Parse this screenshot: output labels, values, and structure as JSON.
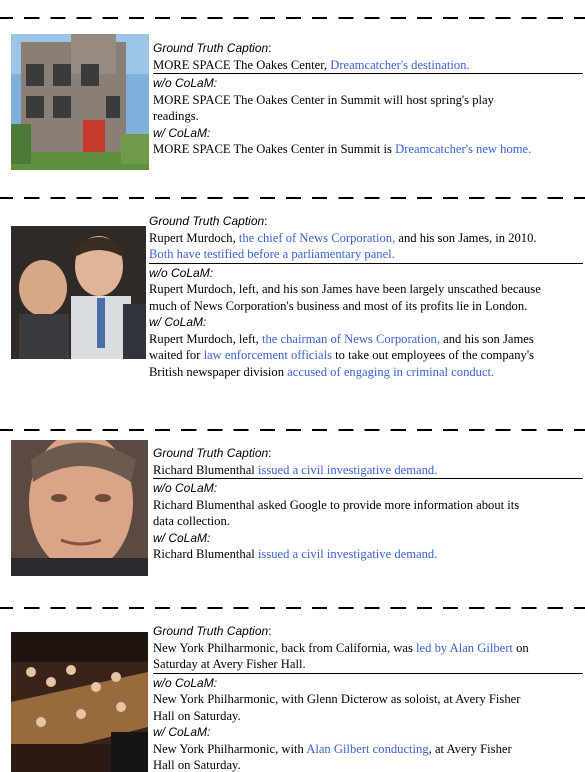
{
  "labels": {
    "gt": "Ground Truth Caption",
    "gt_colon": ":",
    "wo": "w/o CoLaM:",
    "w": "w/ CoLaM:"
  },
  "colors": {
    "highlight": "#3a62d6",
    "text": "#000000"
  },
  "examples": [
    {
      "image": "stone-building-photo",
      "gt": {
        "lines": [
          [
            {
              "t": "MORE SPACE The Oakes Center, ",
              "h": false
            },
            {
              "t": "Dreamcatcher's destination.",
              "h": true
            }
          ]
        ]
      },
      "wo": {
        "lines": [
          [
            {
              "t": "MORE SPACE The Oakes Center in Summit will host spring's play",
              "h": false
            }
          ],
          [
            {
              "t": "readings.",
              "h": false
            }
          ]
        ]
      },
      "w": {
        "lines": [
          [
            {
              "t": "MORE SPACE The Oakes Center in Summit is ",
              "h": false
            },
            {
              "t": "Dreamcatcher's new home.",
              "h": true
            }
          ]
        ]
      }
    },
    {
      "image": "two-men-photo",
      "gt": {
        "lines": [
          [
            {
              "t": "Rupert Murdoch, ",
              "h": false
            },
            {
              "t": "the chief of News Corporation,",
              "h": true
            },
            {
              "t": " and his son James, in 2010.",
              "h": false
            }
          ],
          [
            {
              "t": "Both have testified before a parliamentary panel.",
              "h": true
            }
          ]
        ]
      },
      "wo": {
        "lines": [
          [
            {
              "t": "Rupert Murdoch, left, and his son James have been largely unscathed because",
              "h": false
            }
          ],
          [
            {
              "t": "much of News Corporation's business and most of its profits lie in London.",
              "h": false
            }
          ]
        ]
      },
      "w": {
        "lines": [
          [
            {
              "t": "Rupert Murdoch, left, ",
              "h": false
            },
            {
              "t": "the chairman of News Corporation,",
              "h": true
            },
            {
              "t": " and his son James",
              "h": false
            }
          ],
          [
            {
              "t": "waited for ",
              "h": false
            },
            {
              "t": "law enforcement officials",
              "h": true
            },
            {
              "t": " to take out employees of the company's",
              "h": false
            }
          ],
          [
            {
              "t": "British newspaper division ",
              "h": false
            },
            {
              "t": "accused of engaging in criminal conduct.",
              "h": true
            }
          ]
        ]
      }
    },
    {
      "image": "man-portrait-photo",
      "gt": {
        "lines": [
          [
            {
              "t": "Richard Blumenthal ",
              "h": false
            },
            {
              "t": "issued a civil investigative demand.",
              "h": true
            }
          ]
        ]
      },
      "wo": {
        "lines": [
          [
            {
              "t": "Richard Blumenthal asked Google to provide more information about its",
              "h": false
            }
          ],
          [
            {
              "t": "data collection.",
              "h": false
            }
          ]
        ]
      },
      "w": {
        "lines": [
          [
            {
              "t": "Richard Blumenthal ",
              "h": false
            },
            {
              "t": "issued a civil investigative demand.",
              "h": true
            }
          ]
        ]
      }
    },
    {
      "image": "orchestra-photo",
      "gt": {
        "lines": [
          [
            {
              "t": "New York Philharmonic, back from California, was ",
              "h": false
            },
            {
              "t": "led by Alan Gilbert",
              "h": true
            },
            {
              "t": " on",
              "h": false
            }
          ],
          [
            {
              "t": "Saturday at Avery Fisher Hall.",
              "h": false
            }
          ]
        ]
      },
      "wo": {
        "lines": [
          [
            {
              "t": "New York Philharmonic, with Glenn Dicterow as soloist, at Avery Fisher",
              "h": false
            }
          ],
          [
            {
              "t": "Hall on Saturday.",
              "h": false
            }
          ]
        ]
      },
      "w": {
        "lines": [
          [
            {
              "t": "New York Philharmonic, with ",
              "h": false
            },
            {
              "t": "Alan Gilbert conducting",
              "h": true
            },
            {
              "t": ", at Avery Fisher",
              "h": false
            }
          ],
          [
            {
              "t": "Hall on Saturday.",
              "h": false
            }
          ]
        ]
      }
    }
  ]
}
